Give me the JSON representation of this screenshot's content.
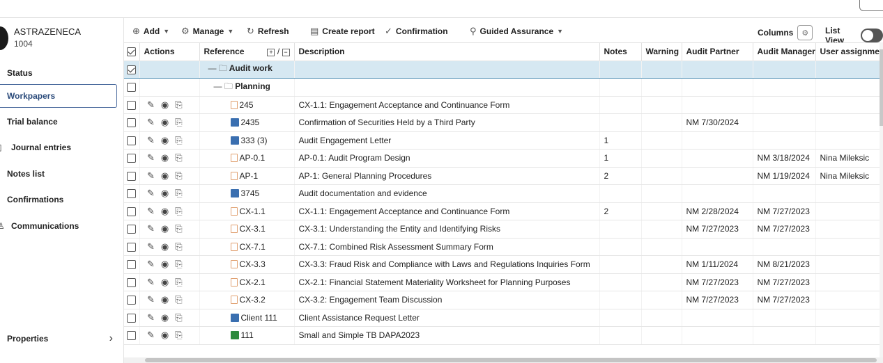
{
  "client": {
    "name": "ASTRAZENECA",
    "number": "1004"
  },
  "sidebar": {
    "items": [
      {
        "label": "Status",
        "icon": "none"
      },
      {
        "label": "Workpapers",
        "icon": "none",
        "active": true
      },
      {
        "label": "Trial balance",
        "icon": "none"
      },
      {
        "label": "Journal entries",
        "icon": "journal-icon"
      },
      {
        "label": "Notes list",
        "icon": "none"
      },
      {
        "label": "Confirmations",
        "icon": "none"
      },
      {
        "label": "Communications",
        "icon": "person-icon"
      }
    ],
    "properties_label": "Properties"
  },
  "toolbar": {
    "add": "Add",
    "manage": "Manage",
    "refresh": "Refresh",
    "create_report": "Create report",
    "confirmation": "Confirmation",
    "guided_assurance": "Guided Assurance",
    "columns": "Columns",
    "list_view": "List View"
  },
  "table": {
    "headers": {
      "actions": "Actions",
      "reference": "Reference",
      "description": "Description",
      "notes": "Notes",
      "warning": "Warning",
      "audit_partner": "Audit Partner",
      "audit_manager": "Audit Manager",
      "user_assigned": "User assignme"
    },
    "folder_audit_work": "Audit work",
    "folder_planning": "Planning",
    "rows": [
      {
        "ref": "245",
        "icon": "pdf",
        "desc": "CX-1.1: Engagement Acceptance and Continuance Form",
        "notes": "",
        "partner": "",
        "manager": "",
        "user": ""
      },
      {
        "ref": "2435",
        "icon": "doc",
        "desc": "Confirmation of Securities Held by a Third Party",
        "notes": "",
        "partner": "NM 7/30/2024",
        "manager": "",
        "user": ""
      },
      {
        "ref": "333 (3)",
        "icon": "doc",
        "desc": "Audit Engagement Letter",
        "notes": "1",
        "partner": "",
        "manager": "",
        "user": ""
      },
      {
        "ref": "AP-0.1",
        "icon": "pdf",
        "desc": "AP-0.1: Audit Program Design",
        "notes": "1",
        "partner": "",
        "manager": "NM 3/18/2024",
        "user": "Nina Mileksic"
      },
      {
        "ref": "AP-1",
        "icon": "pdf",
        "desc": "AP-1: General Planning Procedures",
        "notes": "2",
        "partner": "",
        "manager": "NM 1/19/2024",
        "user": "Nina Mileksic"
      },
      {
        "ref": "3745",
        "icon": "doc",
        "desc": "Audit documentation and evidence",
        "notes": "",
        "partner": "",
        "manager": "",
        "user": ""
      },
      {
        "ref": "CX-1.1",
        "icon": "pdf",
        "desc": "CX-1.1: Engagement Acceptance and Continuance Form",
        "notes": "2",
        "partner": "NM 2/28/2024",
        "manager": "NM 7/27/2023",
        "user": ""
      },
      {
        "ref": "CX-3.1",
        "icon": "pdf",
        "desc": "CX-3.1: Understanding the Entity and Identifying Risks",
        "notes": "",
        "partner": "NM 7/27/2023",
        "manager": "NM 7/27/2023",
        "user": ""
      },
      {
        "ref": "CX-7.1",
        "icon": "pdf",
        "desc": "CX-7.1: Combined Risk Assessment Summary Form",
        "notes": "",
        "partner": "",
        "manager": "",
        "user": ""
      },
      {
        "ref": "CX-3.3",
        "icon": "pdf",
        "desc": "CX-3.3: Fraud Risk and Compliance with Laws and Regulations Inquiries Form",
        "notes": "",
        "partner": "NM 1/11/2024",
        "manager": "NM 8/21/2023",
        "user": ""
      },
      {
        "ref": "CX-2.1",
        "icon": "pdf",
        "desc": "CX-2.1: Financial Statement Materiality Worksheet for Planning Purposes",
        "notes": "",
        "partner": "NM 7/27/2023",
        "manager": "NM 7/27/2023",
        "user": ""
      },
      {
        "ref": "CX-3.2",
        "icon": "pdf",
        "desc": "CX-3.2: Engagement Team Discussion",
        "notes": "",
        "partner": "NM 7/27/2023",
        "manager": "NM 7/27/2023",
        "user": ""
      },
      {
        "ref": "Client 111",
        "icon": "doc",
        "desc": "Client Assistance Request Letter",
        "notes": "",
        "partner": "",
        "manager": "",
        "user": ""
      },
      {
        "ref": "111",
        "icon": "xls",
        "desc": "Small and Simple TB DAPA2023",
        "notes": "",
        "partner": "",
        "manager": "",
        "user": ""
      }
    ]
  }
}
